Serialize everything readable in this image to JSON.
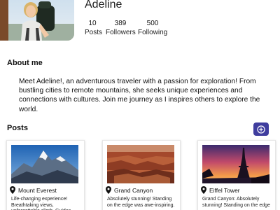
{
  "profile": {
    "name": "Adeline",
    "stats": [
      {
        "value": "10",
        "label": "Posts"
      },
      {
        "value": "389",
        "label": "Followers"
      },
      {
        "value": "500",
        "label": "Following"
      }
    ]
  },
  "about": {
    "heading": "About me",
    "text": "Meet Adeline!, an adventurous traveler with a passion for exploration! From bustling cities to remote mountains, she seeks unique experiences and connections with cultures. Join me journey as I inspires others to explore the world."
  },
  "posts": {
    "heading": "Posts",
    "add_icon": "plus-circle-icon",
    "items": [
      {
        "location": "Mount Everest",
        "caption": "Life-changing experience! Breathtaking views, unforgettable climb. Guides",
        "image": "mountain-photo"
      },
      {
        "location": "Grand Canyon",
        "caption": "Absolutely stunning! Standing on the edge was awe-inspiring.",
        "image": "canyon-photo"
      },
      {
        "location": "Eiffel Tower",
        "caption": "Grand Canyon: Absolutely stunning! Standing on the edge",
        "image": "eiffel-tower-photo"
      }
    ]
  },
  "colors": {
    "accent": "#3f3d9e",
    "avatar_frame": "#7a4a2a"
  }
}
